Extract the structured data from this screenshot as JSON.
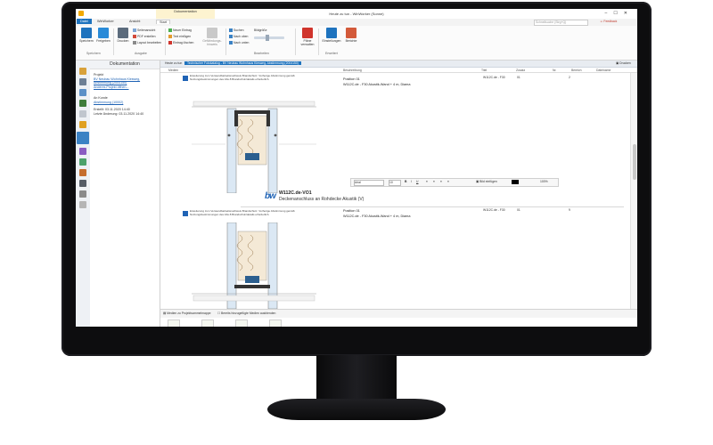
{
  "window": {
    "title": "Heute zu tun - WinWorker (Sonne)",
    "context_tab": "Dokumentation"
  },
  "ribbon_tabs": [
    "Datei",
    "WinWorker",
    "Ansicht",
    "Start"
  ],
  "ribbon": {
    "save": "Speichern",
    "share": "Freigeben",
    "print": "Drucken",
    "page_layout": "Seitenansicht",
    "pdf": "PDF erstellen",
    "layout_edit": "Layout bearbeiten",
    "new_entry": "Neuer Eintrag",
    "insert_text": "Text einfügen",
    "delete_entry": "Eintrag löschen",
    "hazard_notes": "Gefährdungs-hinweis",
    "search": "Suchen",
    "up": "Nach oben",
    "down": "Nach unten",
    "image_size": "Bildgröße",
    "plans": "Pläne verwalten",
    "settings": "Einstellungen",
    "reports": "Berichte",
    "groups": [
      "Speichern",
      "Ausgabe",
      "Bearbeiten",
      "Erweitert"
    ]
  },
  "feedback": "Feedback",
  "search_placeholder": "Schnellsuche (Strg+Q)",
  "left_panel": {
    "title": "Dokumentation",
    "project_label": "Projekt",
    "project_link": "BV Neubau Wohnhaus Kiesweg, Abstimmung (2004150)",
    "change_project": "Anderes Projekt öffnen...",
    "customer_label": "An Kunde",
    "customer_link": "Abstimmung (10002)",
    "created": "Erstellt:  03.11.2020 14:40",
    "changed": "Letzte Änderung: 03.11.2020 14:40"
  },
  "doc_tabs": [
    "Heute zu tun",
    "Technischer Fotokatalog - BV Neubau Wohnhaus Kiesweg, Abstimmung (2004150)"
  ],
  "print_label": "Drucken",
  "columns": [
    "Medien",
    "Beschreibung",
    "Titel",
    "Zusatz",
    "Nr.",
    "Bereich",
    "Dateiname"
  ],
  "entries": [
    {
      "note": "Erweiterung zum Verwendbarkeitsnachweis Brandschutz. Vorherige Abstimmung gemäß Nutzungsbestimmungen des Abs.8 Brandschutzdetails erforderlich.",
      "position": "Position 01",
      "description": "W112C.de - F30 Akustik-Wand + 4 m, Diama",
      "title": "W112C.de - F30",
      "zusatz": "01",
      "bereich": "2"
    },
    {
      "note": "Erweiterung zum Verwendbarkeitsnachweis Brandschutz. Vorherige Abstimmung gemäß Nutzungsbestimmungen des Abs.8 Brandschutzdetails erforderlich.",
      "position": "Position 01",
      "description": "W112C.de - F30 Akustik-Wand + 4 m, Diama",
      "title": "W112C.de - F30",
      "zusatz": "01",
      "bereich": "9"
    }
  ],
  "section": {
    "logo": "bw",
    "code": "W112C.de-VO1",
    "subtitle": "Deckenanschluss an Rohdecke Akustik (V)"
  },
  "format_bar": {
    "font": "Arial",
    "size": "10",
    "insert_image": "Bild einfügen",
    "zoom": "100%"
  },
  "media_bar": {
    "add": "Medien zu Projektsammelmappe",
    "hide": "Bereits hinzugefügte Medien ausblenden"
  },
  "colors": {
    "accent": "#1e73be",
    "link": "#1f63b5"
  }
}
